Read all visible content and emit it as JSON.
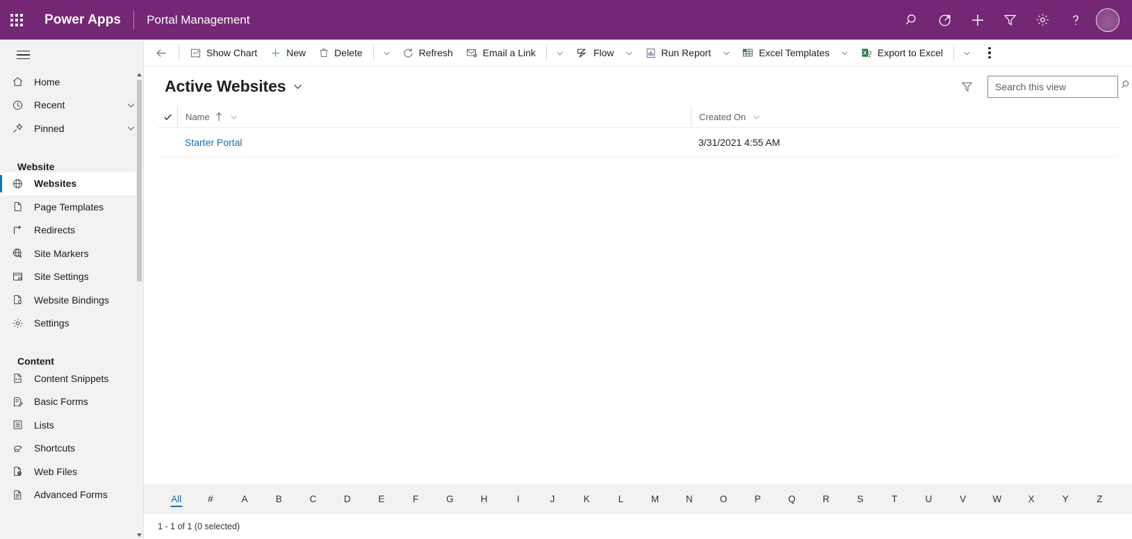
{
  "appbar": {
    "waffle_name": "app-launcher",
    "brand": "Power Apps",
    "app_name": "Portal Management",
    "actions": [
      {
        "name": "search-icon",
        "label": "Search"
      },
      {
        "name": "diagnostics-icon",
        "label": "Diagnostics"
      },
      {
        "name": "plus-icon",
        "label": "New"
      },
      {
        "name": "filter-icon",
        "label": "Filter"
      },
      {
        "name": "gear-icon",
        "label": "Settings"
      },
      {
        "name": "help-icon",
        "label": "Help"
      }
    ],
    "avatar_label": "User profile",
    "brand_color": "#742774"
  },
  "sidebar": {
    "hamburger_label": "Expand navigation",
    "top_items": [
      {
        "label": "Home",
        "icon": "home-icon",
        "caret": false,
        "selected": false
      },
      {
        "label": "Recent",
        "icon": "clock-icon",
        "caret": true,
        "selected": false
      },
      {
        "label": "Pinned",
        "icon": "pin-icon",
        "caret": true,
        "selected": false
      }
    ],
    "groups": [
      {
        "title": "Website",
        "items": [
          {
            "label": "Websites",
            "icon": "globe-icon",
            "selected": true
          },
          {
            "label": "Page Templates",
            "icon": "page-icon",
            "selected": false
          },
          {
            "label": "Redirects",
            "icon": "redirect-icon",
            "selected": false
          },
          {
            "label": "Site Markers",
            "icon": "globe-star-icon",
            "selected": false
          },
          {
            "label": "Site Settings",
            "icon": "site-settings-icon",
            "selected": false
          },
          {
            "label": "Website Bindings",
            "icon": "binding-icon",
            "selected": false
          },
          {
            "label": "Settings",
            "icon": "gear-icon",
            "selected": false
          }
        ]
      },
      {
        "title": "Content",
        "items": [
          {
            "label": "Content Snippets",
            "icon": "code-page-icon",
            "selected": false
          },
          {
            "label": "Basic Forms",
            "icon": "form-edit-icon",
            "selected": false
          },
          {
            "label": "Lists",
            "icon": "list-icon",
            "selected": false
          },
          {
            "label": "Shortcuts",
            "icon": "shortcut-icon",
            "selected": false
          },
          {
            "label": "Web Files",
            "icon": "web-file-icon",
            "selected": false
          },
          {
            "label": "Advanced Forms",
            "icon": "adv-form-icon",
            "selected": false
          }
        ]
      }
    ]
  },
  "commandbar": {
    "back_label": "Back",
    "commands": [
      {
        "label": "Show Chart",
        "icon": "chart-icon",
        "caret": false
      },
      {
        "label": "New",
        "icon": "plus-icon",
        "caret": false
      },
      {
        "label": "Delete",
        "icon": "trash-icon",
        "caret": true,
        "divider_before_caret": true
      },
      {
        "label": "Refresh",
        "icon": "refresh-icon",
        "caret": false
      },
      {
        "label": "Email a Link",
        "icon": "email-icon",
        "caret": true,
        "divider_before_caret": true
      },
      {
        "label": "Flow",
        "icon": "flow-icon",
        "caret": true
      },
      {
        "label": "Run Report",
        "icon": "report-icon",
        "caret": true
      },
      {
        "label": "Excel Templates",
        "icon": "excel-template-icon",
        "caret": true
      },
      {
        "label": "Export to Excel",
        "icon": "excel-icon",
        "caret": true,
        "divider_before_caret": true
      }
    ],
    "more_label": "More commands"
  },
  "view": {
    "title": "Active Websites",
    "caret_label": "Change view",
    "filter_label": "Edit filters",
    "search_placeholder": "Search this view",
    "search_value": ""
  },
  "grid": {
    "select_all_label": "Select all",
    "columns": [
      {
        "label": "Name",
        "sort": "ascending",
        "sort_glyph": "↑"
      },
      {
        "label": "Created On",
        "sort": "none",
        "sort_glyph": ""
      }
    ],
    "rows": [
      {
        "name": "Starter Portal",
        "created_on": "3/31/2021 4:55 AM"
      }
    ]
  },
  "alpha_filter": {
    "letters": [
      "All",
      "#",
      "A",
      "B",
      "C",
      "D",
      "E",
      "F",
      "G",
      "H",
      "I",
      "J",
      "K",
      "L",
      "M",
      "N",
      "O",
      "P",
      "Q",
      "R",
      "S",
      "T",
      "U",
      "V",
      "W",
      "X",
      "Y",
      "Z"
    ],
    "active": "All"
  },
  "status": {
    "text": "1 - 1 of 1 (0 selected)"
  },
  "colors": {
    "brand_purple": "#742774",
    "accent_blue": "#0f6cbd",
    "selection_blue": "#0078d4",
    "sidebar_bg": "#f3f2f1"
  }
}
